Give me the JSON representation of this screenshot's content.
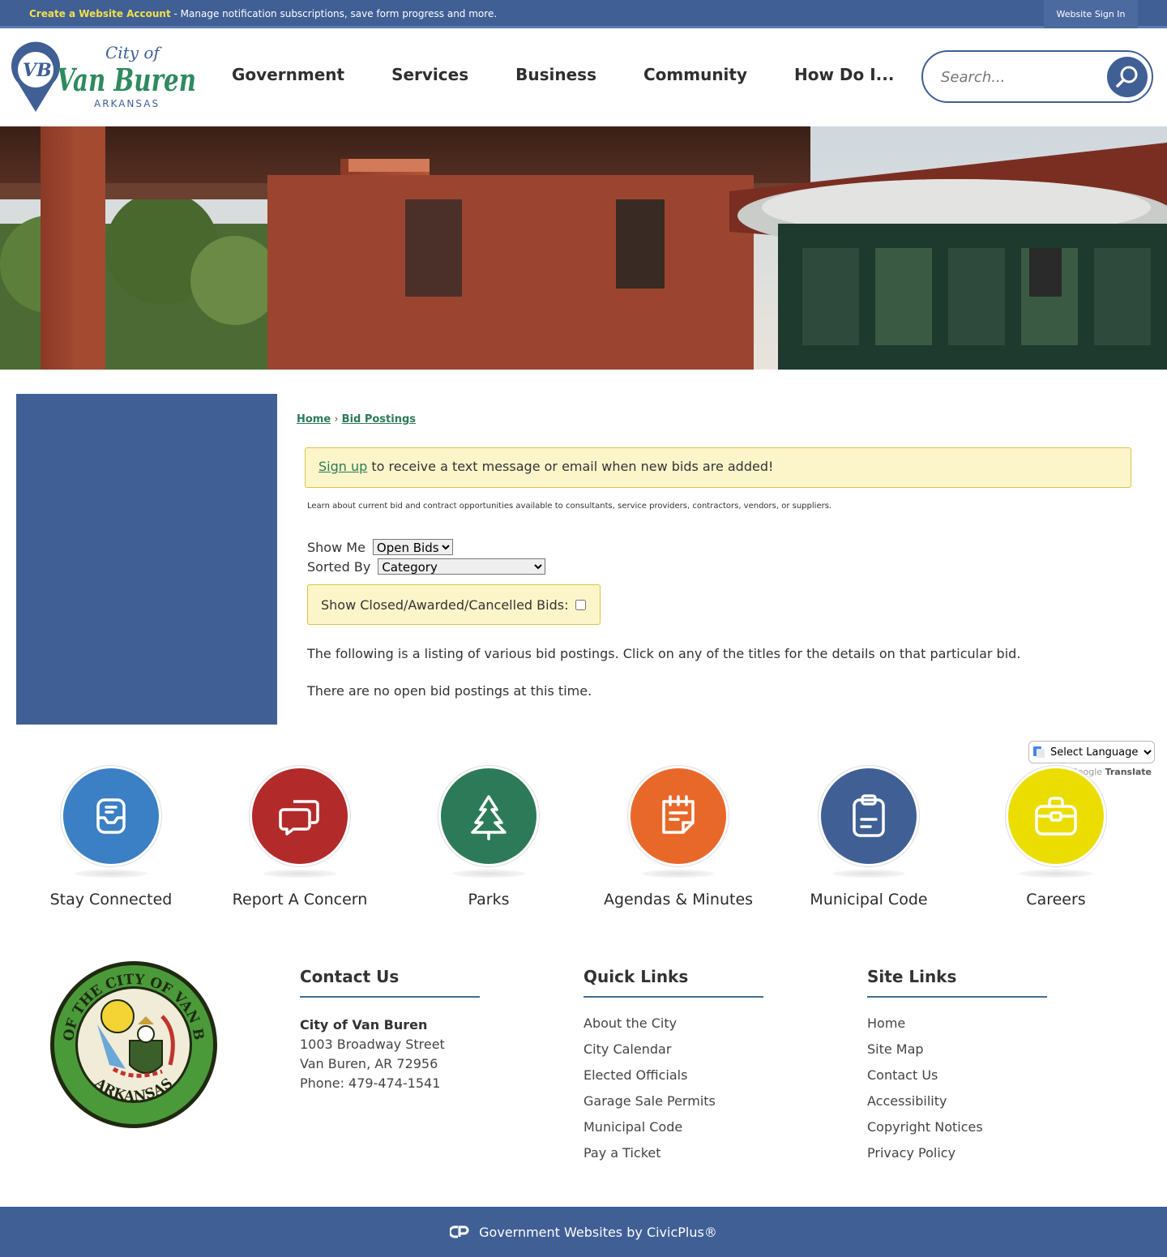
{
  "topbar": {
    "create_account": "Create a Website Account",
    "message": " - Manage notification subscriptions, save form progress and more.",
    "sign_in": "Website Sign In"
  },
  "logo": {
    "city_of": "City of",
    "initials": "VB",
    "name": "Van Buren",
    "state": "ARKANSAS",
    "colors": {
      "green": "#2f8a5f",
      "blue": "#3f5f95"
    }
  },
  "nav": [
    "Government",
    "Services",
    "Business",
    "Community",
    "How Do I..."
  ],
  "search": {
    "placeholder": "Search..."
  },
  "breadcrumb": {
    "home": "Home",
    "sep": " › ",
    "current": "Bid Postings"
  },
  "alert": {
    "link": "Sign up",
    "text": " to receive a text message or email when new bids are added!"
  },
  "intro": "Learn about current bid and contract opportunities available to consultants, service providers, contractors, vendors, or suppliers.",
  "filters": {
    "show_me_label": "Show Me",
    "show_me_value": "Open Bids",
    "sorted_by_label": "Sorted By",
    "sorted_by_value": "Category"
  },
  "closed_label": "Show Closed/Awarded/Cancelled Bids:",
  "listing_text": "The following is a listing of various bid postings. Click on any of the titles for the details on that particular bid.",
  "no_bids_text": "There are no open bid postings at this time.",
  "translate": {
    "select": "Select Language",
    "powered": "Google",
    "translate": "Translate"
  },
  "quick_links": [
    {
      "label": "Stay Connected",
      "color": "#3b7fc4",
      "icon": "inbox-icon"
    },
    {
      "label": "Report A Concern",
      "color": "#b22a2a",
      "icon": "chat-icon"
    },
    {
      "label": "Parks",
      "color": "#2c7a58",
      "icon": "tree-icon"
    },
    {
      "label": "Agendas & Minutes",
      "color": "#e8682a",
      "icon": "notepad-icon"
    },
    {
      "label": "Municipal Code",
      "color": "#3f5f95",
      "icon": "clipboard-icon"
    },
    {
      "label": "Careers",
      "color": "#ebdd00",
      "icon": "briefcase-icon"
    }
  ],
  "seal": {
    "top_text": "SEAL OF THE CITY OF VAN BUREN",
    "bottom_text": "ARKANSAS"
  },
  "contact": {
    "title": "Contact Us",
    "org": "City of Van Buren",
    "street": "1003 Broadway Street",
    "city": "Van Buren, AR 72956",
    "phone": "Phone: 479-474-1541"
  },
  "quick_links_footer": {
    "title": "Quick Links",
    "items": [
      "About the City",
      "City Calendar",
      "Elected Officials",
      "Garage Sale Permits",
      "Municipal Code",
      "Pay a Ticket"
    ]
  },
  "site_links": {
    "title": "Site Links",
    "items": [
      "Home",
      "Site Map",
      "Contact Us",
      "Accessibility",
      "Copyright Notices",
      "Privacy Policy"
    ]
  },
  "footer": {
    "credit": "Government Websites by CivicPlus®"
  }
}
